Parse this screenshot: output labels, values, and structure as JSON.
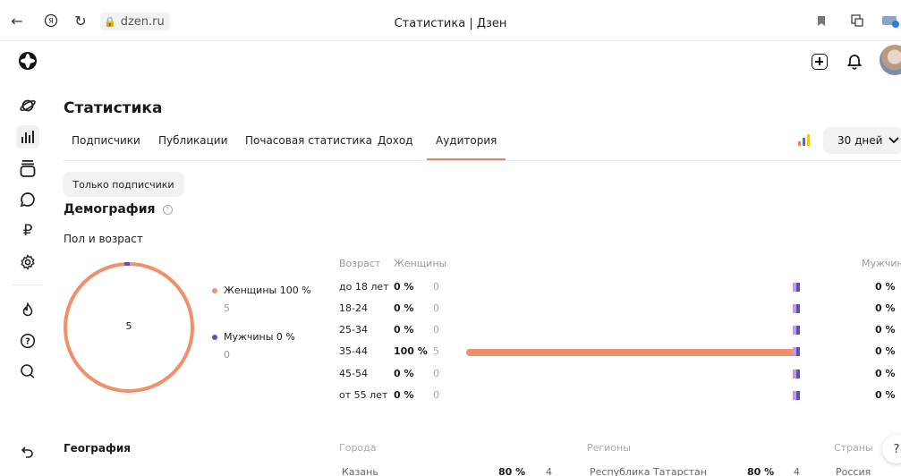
{
  "browser": {
    "address": "dzen.ru",
    "tab_title": "Статистика | Дзен"
  },
  "page": {
    "title": "Статистика",
    "tabs": [
      "Подписчики",
      "Публикации",
      "Почасовая статистика",
      "Доход",
      "Аудитория"
    ],
    "active_tab": "Аудитория",
    "period": "30 дней",
    "subscribers_only": "Только подписчики"
  },
  "demography": {
    "title": "Демография",
    "subtitle": "Пол и возраст",
    "total": "5",
    "legend": [
      {
        "label": "Женщины 100 %",
        "count": "5",
        "color": "#f0906a"
      },
      {
        "label": "Мужчины 0 %",
        "count": "0",
        "color": "#5b4fc4"
      }
    ],
    "headers": {
      "age": "Возраст",
      "women": "Женщины",
      "men": "Мужчины"
    },
    "rows": [
      {
        "age": "до 18 лет",
        "women_pct": "0 %",
        "women_cnt": "0",
        "women_share": 0,
        "men_pct": "0 %"
      },
      {
        "age": "18-24",
        "women_pct": "0 %",
        "women_cnt": "0",
        "women_share": 0,
        "men_pct": "0 %"
      },
      {
        "age": "25-34",
        "women_pct": "0 %",
        "women_cnt": "0",
        "women_share": 0,
        "men_pct": "0 %"
      },
      {
        "age": "35-44",
        "women_pct": "100 %",
        "women_cnt": "5",
        "women_share": 100,
        "men_pct": "0 %"
      },
      {
        "age": "45-54",
        "women_pct": "0 %",
        "women_cnt": "0",
        "women_share": 0,
        "men_pct": "0 %"
      },
      {
        "age": "от 55 лет",
        "women_pct": "0 %",
        "women_cnt": "0",
        "women_share": 0,
        "men_pct": "0 %"
      }
    ]
  },
  "geography": {
    "title": "География",
    "cities_h": "Города",
    "regions_h": "Регионы",
    "countries_h": "Страны",
    "city": "Казань",
    "city_pct": "80 %",
    "city_cnt": "4",
    "region": "Республика Татарстан",
    "region_pct": "80 %",
    "region_cnt": "4",
    "country": "Россия"
  },
  "help_label": "?",
  "colors": {
    "accent": "#f0815c",
    "women": "#f0906a",
    "men": "#5b4fc4"
  }
}
